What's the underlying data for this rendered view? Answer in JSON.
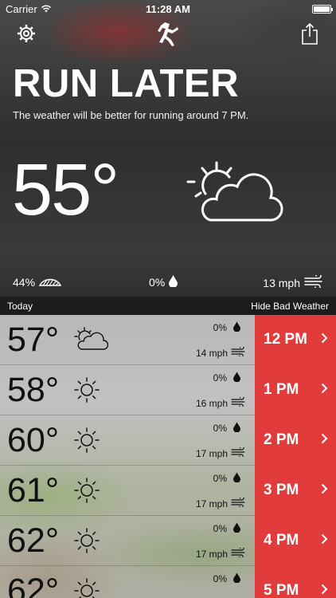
{
  "status_bar": {
    "carrier": "Carrier",
    "time": "11:28 AM"
  },
  "header": {
    "headline": "RUN LATER",
    "subline": "The weather will be better for running around 7 PM.",
    "temperature": "55°"
  },
  "stats": {
    "humidity": "44%",
    "precip": "0%",
    "wind": "13 mph"
  },
  "today_bar": {
    "label": "Today",
    "action": "Hide Bad Weather"
  },
  "colors": {
    "accent": "#e23b3b",
    "text_dark": "#111111"
  },
  "hours": [
    {
      "temp": "57°",
      "icon": "partly-cloudy-icon",
      "precip": "0%",
      "wind": "14 mph",
      "time": "12 PM"
    },
    {
      "temp": "58°",
      "icon": "sun-icon",
      "precip": "0%",
      "wind": "16 mph",
      "time": "1 PM"
    },
    {
      "temp": "60°",
      "icon": "sun-icon",
      "precip": "0%",
      "wind": "17 mph",
      "time": "2 PM"
    },
    {
      "temp": "61°",
      "icon": "sun-icon",
      "precip": "0%",
      "wind": "17 mph",
      "time": "3 PM"
    },
    {
      "temp": "62°",
      "icon": "sun-icon",
      "precip": "0%",
      "wind": "17 mph",
      "time": "4 PM"
    },
    {
      "temp": "62°",
      "icon": "sun-icon",
      "precip": "0%",
      "wind": "",
      "time": "5 PM"
    }
  ]
}
